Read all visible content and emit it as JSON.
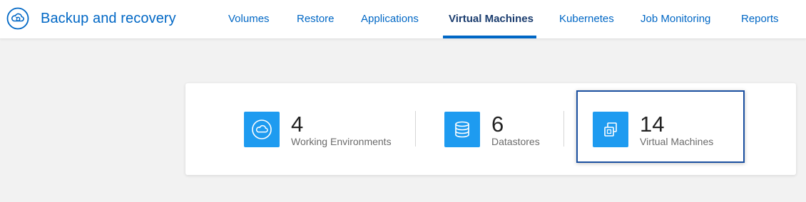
{
  "app": {
    "title": "Backup and recovery",
    "icon": "cloud-refresh-icon",
    "accent_color": "#0067c5"
  },
  "nav": {
    "items": [
      {
        "label": "Volumes",
        "active": false
      },
      {
        "label": "Restore",
        "active": false
      },
      {
        "label": "Applications",
        "active": false
      },
      {
        "label": "Virtual Machines",
        "active": true
      },
      {
        "label": "Kubernetes",
        "active": false
      },
      {
        "label": "Job Monitoring",
        "active": false
      },
      {
        "label": "Reports",
        "active": false
      }
    ]
  },
  "summary": {
    "stats": [
      {
        "value": "4",
        "label": "Working Environments",
        "icon": "cloud-icon"
      },
      {
        "value": "6",
        "label": "Datastores",
        "icon": "database-icon"
      },
      {
        "value": "14",
        "label": "Virtual Machines",
        "icon": "virtual-machines-icon",
        "highlighted": true
      }
    ],
    "icon_color": "#1e9bf0",
    "highlight_color": "#1a4fa0"
  }
}
